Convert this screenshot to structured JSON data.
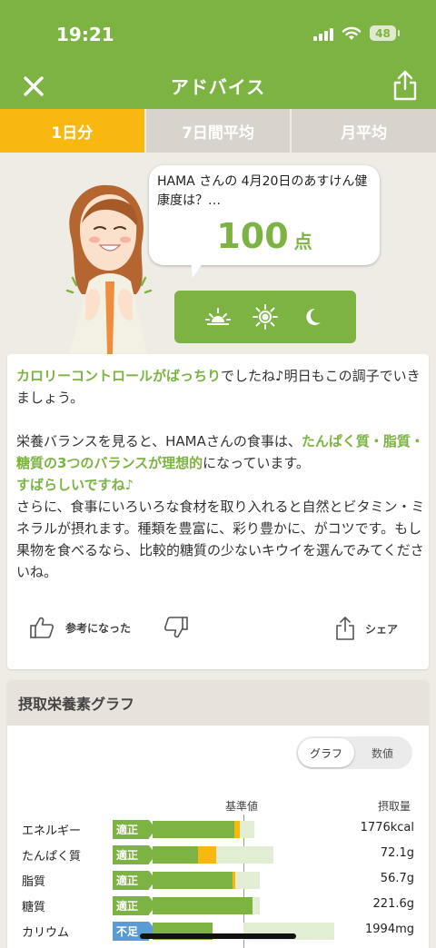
{
  "status": {
    "time": "19:21",
    "battery": "48"
  },
  "nav": {
    "title": "アドバイス"
  },
  "tabs": [
    {
      "label": "1日分",
      "active": true
    },
    {
      "label": "7日間平均",
      "active": false
    },
    {
      "label": "月平均",
      "active": false
    }
  ],
  "hero": {
    "bubble_text": "HAMA さんの 4月20日のあすけん健康度は？…",
    "score": "100",
    "score_unit": "点",
    "time_icons": [
      "sunrise-icon",
      "sun-icon",
      "moon-icon"
    ]
  },
  "advice": {
    "p1_hl": "カロリーコントロールがばっちり",
    "p1_rest": "でしたね♪明日もこの調子でいきましょう。",
    "p2_pre": "栄養バランスを見ると、HAMAさんの食事は、",
    "p2_hl": "たんぱく質・脂質・糖質の3つのバランスが理想的",
    "p2_post": "になっています。",
    "p2_hl2": "すばらしいですね♪",
    "p2_rest": "さらに、食事にいろいろな食材を取り入れると自然とビタミン・ミネラルが摂れます。種類を豊富に、彩り豊かに、がコツです。もし果物を食べるなら、比較的糖質の少ないキウイを選んでみてくださいね。",
    "like_label": "参考になった",
    "share_label": "シェア"
  },
  "graph": {
    "title": "摂取栄養素グラフ",
    "seg_graph": "グラフ",
    "seg_value": "数値",
    "col_ref": "基準値",
    "col_intake": "摂取量",
    "rows": [
      {
        "name": "エネルギー",
        "status": "適正",
        "value": "1776kcal"
      },
      {
        "name": "たんぱく質",
        "status": "適正",
        "value": "72.1g"
      },
      {
        "name": "脂質",
        "status": "適正",
        "value": "56.7g"
      },
      {
        "name": "糖質",
        "status": "適正",
        "value": "221.6g"
      },
      {
        "name": "カリウム",
        "status": "不足",
        "value": "1994mg"
      }
    ]
  },
  "colors": {
    "brand_green": "#7cb342",
    "accent_yellow": "#f9b80f",
    "low_blue": "#5b9bd5"
  }
}
